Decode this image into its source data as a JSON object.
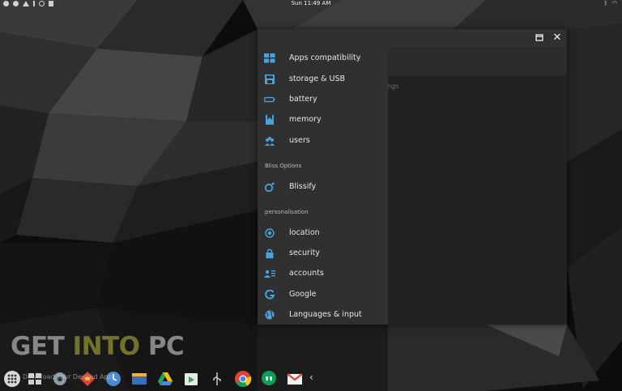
{
  "status_bar": {
    "clock": "Sun 11:49 AM"
  },
  "window": {
    "titlebar_buttons": [
      "maximize-icon",
      "close-icon"
    ],
    "background_text": "ngs"
  },
  "drawer": {
    "items": [
      {
        "label": "Apps compatibility",
        "icon": "apps-grid-icon"
      },
      {
        "label": "storage & USB",
        "icon": "storage-icon"
      },
      {
        "label": "battery",
        "icon": "battery-icon"
      },
      {
        "label": "memory",
        "icon": "memory-icon"
      },
      {
        "label": "users",
        "icon": "users-icon"
      }
    ],
    "sections": [
      {
        "header": "Bliss Options",
        "items": [
          {
            "label": "Blissify",
            "icon": "blissify-icon"
          }
        ]
      },
      {
        "header": "personalisation",
        "items": [
          {
            "label": "location",
            "icon": "location-icon"
          },
          {
            "label": "security",
            "icon": "lock-icon"
          },
          {
            "label": "accounts",
            "icon": "accounts-icon"
          },
          {
            "label": "Google",
            "icon": "google-icon"
          },
          {
            "label": "Languages & input",
            "icon": "globe-icon"
          }
        ]
      }
    ],
    "icon_color": "#4aa3d8"
  },
  "watermark": {
    "part1": "GET ",
    "part2": "INTO",
    "part3": " PC"
  },
  "taskbar": {
    "search_hint": "Download Your Desired App",
    "apps": [
      "app-drawer-icon",
      "recent-apps-icon",
      "settings-icon",
      "maps-icon",
      "clock-icon",
      "files-icon",
      "drive-icon",
      "play-store-icon",
      "usb-icon",
      "chrome-icon",
      "hangouts-icon",
      "gmail-icon",
      "collapse-arrow-icon"
    ]
  }
}
